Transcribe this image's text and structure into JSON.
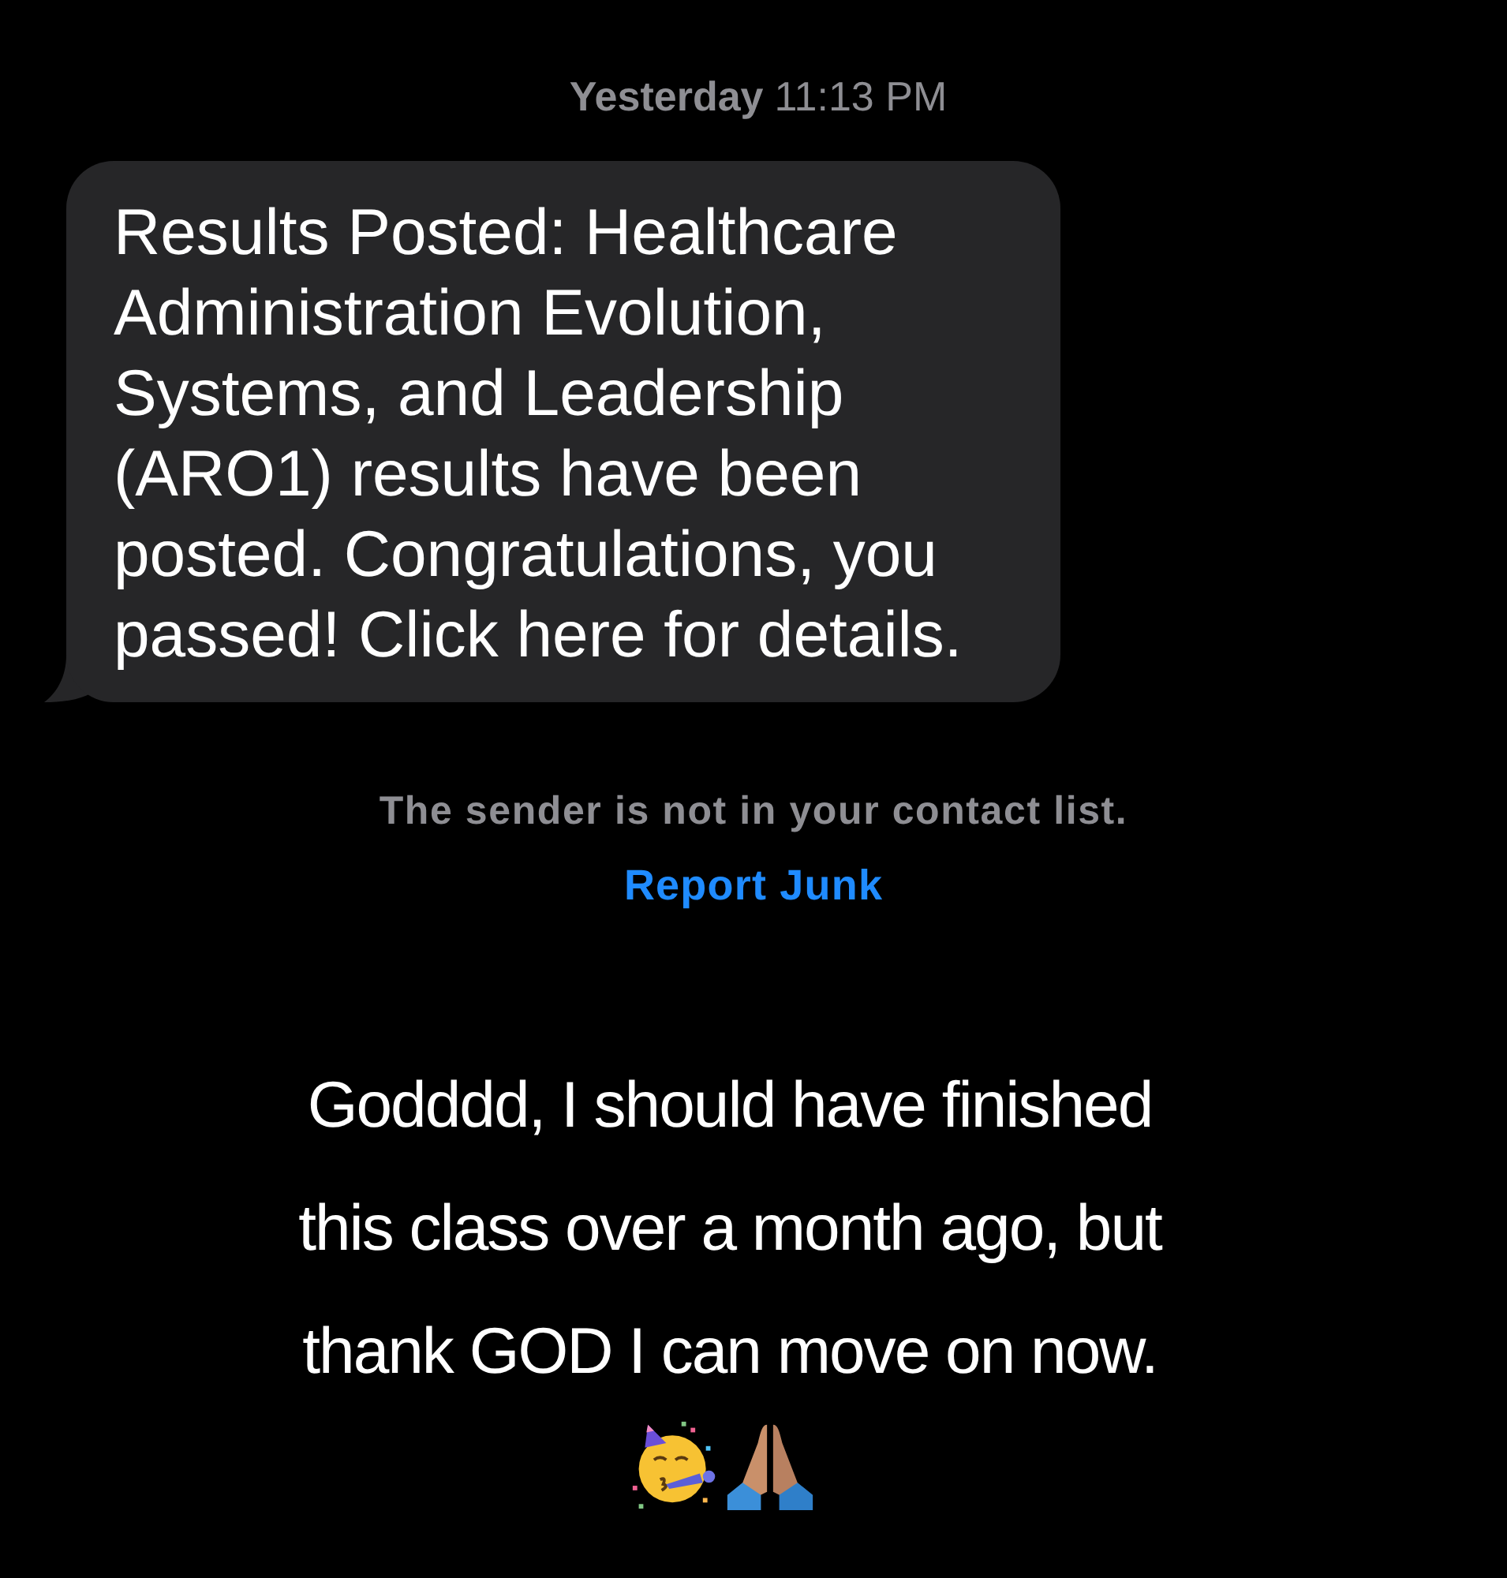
{
  "timestamp": {
    "day": "Yesterday",
    "time": "11:13 PM"
  },
  "message": {
    "text": "Results Posted: Healthcare Administration Evolution, Systems, and Leadership (ARO1) results have been posted. Congratulations, you passed! Click here for details."
  },
  "sender_notice": "The sender is not in your contact list.",
  "report_link": "Report Junk",
  "caption": "Godddd, I should have finished this class over a month ago, but thank GOD I can move on now."
}
